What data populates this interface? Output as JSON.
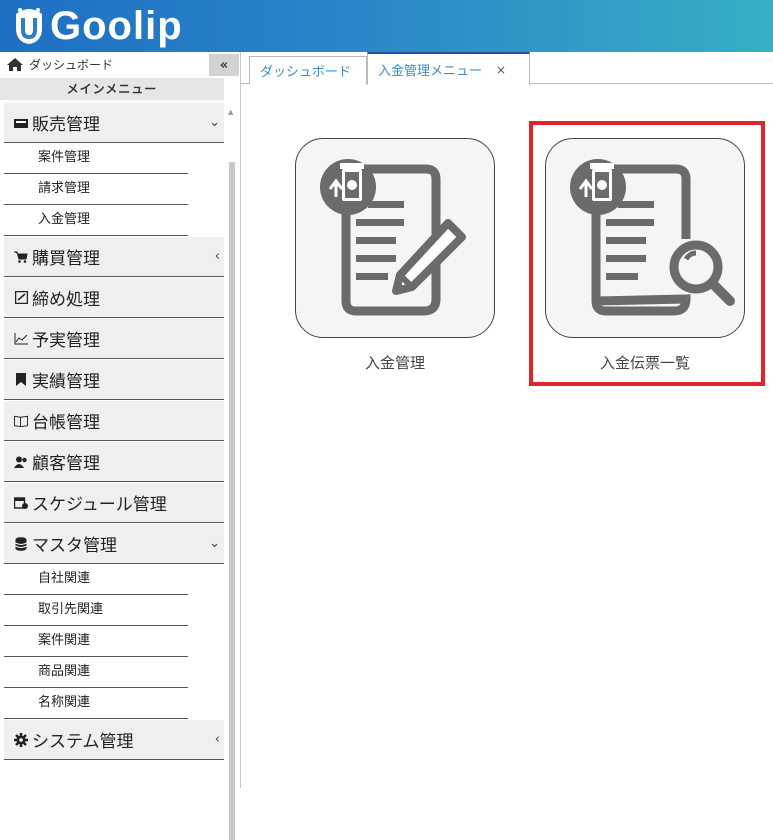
{
  "app": {
    "logo_text": "Goolip"
  },
  "sidebar": {
    "dashboard_link": "ダッシュボード",
    "collapse_label": "«",
    "menu_title": "メインメニュー",
    "groups": [
      {
        "label": "販売管理",
        "icon": "register-icon",
        "chevron": "⌄",
        "items": [
          "案件管理",
          "請求管理",
          "入金管理"
        ]
      },
      {
        "label": "購買管理",
        "icon": "cart-icon",
        "chevron": "‹"
      },
      {
        "label": "締め処理",
        "icon": "checkbox-icon"
      },
      {
        "label": "予実管理",
        "icon": "chart-icon"
      },
      {
        "label": "実績管理",
        "icon": "bookmark-icon"
      },
      {
        "label": "台帳管理",
        "icon": "book-icon"
      },
      {
        "label": "顧客管理",
        "icon": "users-icon"
      },
      {
        "label": "スケジュール管理",
        "icon": "calendar-icon"
      },
      {
        "label": "マスタ管理",
        "icon": "database-icon",
        "chevron": "⌄",
        "items": [
          "自社関連",
          "取引先関連",
          "案件関連",
          "商品関連",
          "名称関連"
        ]
      },
      {
        "label": "システム管理",
        "icon": "gear-icon",
        "chevron": "‹"
      }
    ]
  },
  "tabs": [
    {
      "label": "ダッシュボード"
    },
    {
      "label": "入金管理メニュー",
      "close": "×"
    }
  ],
  "cards": [
    {
      "label": "入金管理",
      "icon": "payment-edit-icon"
    },
    {
      "label": "入金伝票一覧",
      "icon": "payment-search-icon"
    }
  ],
  "colors": {
    "accent": "#1f4fa8",
    "highlight": "#e0242a",
    "tab_text": "#3a8dc9"
  }
}
